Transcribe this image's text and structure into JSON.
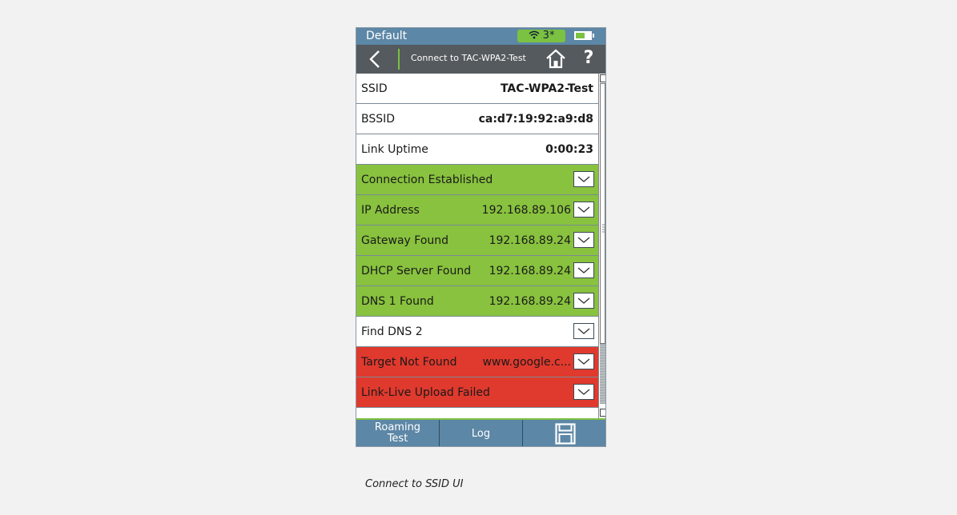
{
  "status_bar": {
    "profile": "Default",
    "wifi_badge": "3*",
    "battery_fraction": 0.6,
    "icons": [
      "wifi-icon",
      "battery-icon"
    ]
  },
  "nav_bar": {
    "title": "Connect to TAC-WPA2-Test",
    "help_label": "?",
    "icons": [
      "back-icon",
      "home-icon"
    ]
  },
  "rows": [
    {
      "label": "SSID",
      "value": "TAC-WPA2-Test",
      "status": "info"
    },
    {
      "label": "BSSID",
      "value": "ca:d7:19:92:a9:d8",
      "status": "info"
    },
    {
      "label": "Link Uptime",
      "value": "0:00:23",
      "status": "info"
    },
    {
      "label": "Connection Established",
      "value": "",
      "status": "pass"
    },
    {
      "label": "IP Address",
      "value": "192.168.89.106",
      "status": "pass"
    },
    {
      "label": "Gateway Found",
      "value": "192.168.89.24",
      "status": "pass"
    },
    {
      "label": "DHCP Server Found",
      "value": "192.168.89.24",
      "status": "pass"
    },
    {
      "label": "DNS 1 Found",
      "value": "192.168.89.24",
      "status": "pass"
    },
    {
      "label": "Find DNS 2",
      "value": "",
      "status": "pending"
    },
    {
      "label": "Target Not Found",
      "value": "www.google.c...",
      "status": "fail"
    },
    {
      "label": "Link-Live Upload Failed",
      "value": "",
      "status": "fail"
    }
  ],
  "bottom_bar": {
    "roaming_line1": "Roaming",
    "roaming_line2": "Test",
    "log": "Log",
    "save_icon": "save-icon"
  },
  "caption": "Connect to SSID UI",
  "colors": {
    "pass": "#88c23e",
    "fail": "#e0392d",
    "header": "#5d87a6",
    "nav": "#555a5e"
  }
}
